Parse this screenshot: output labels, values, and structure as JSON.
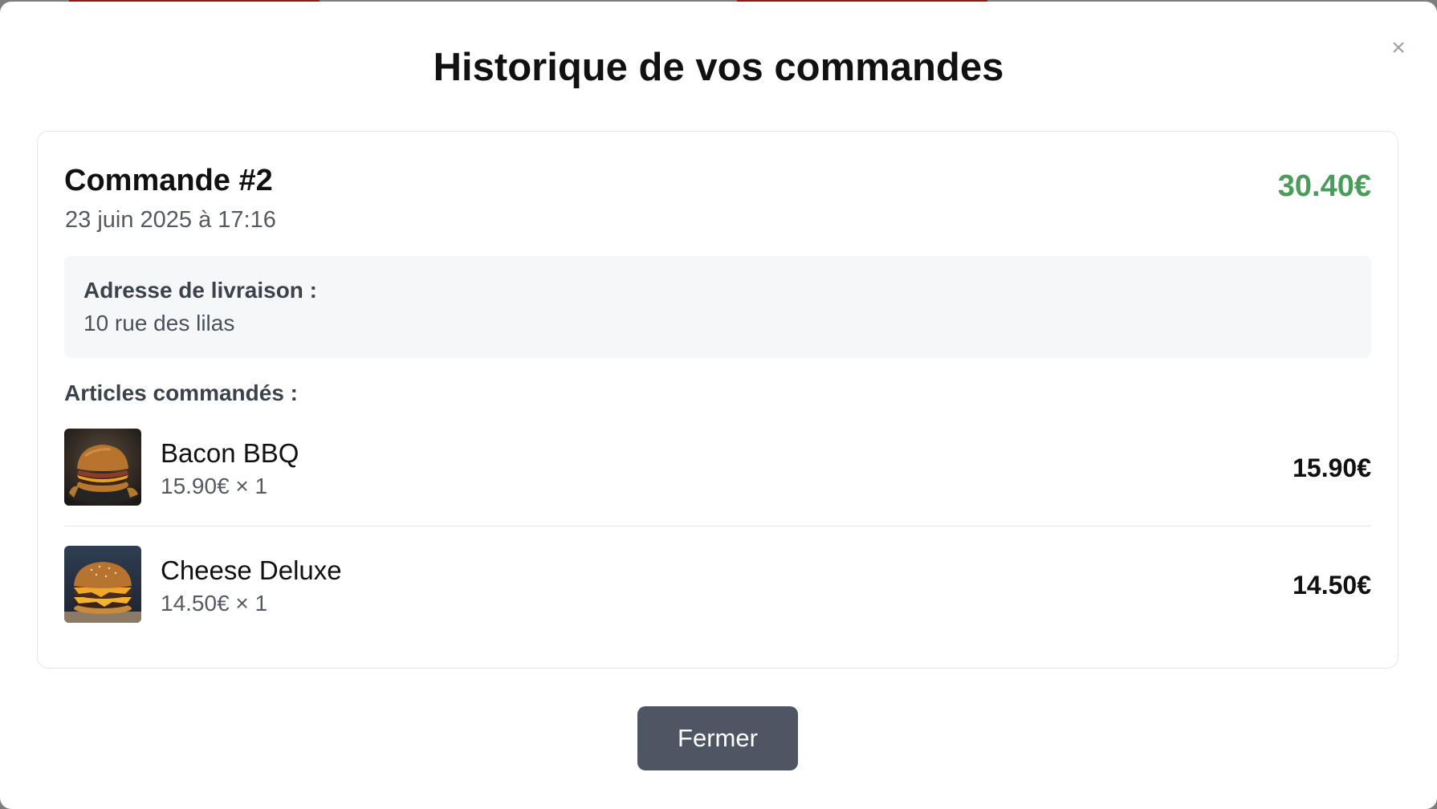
{
  "modal": {
    "title": "Historique de vos commandes",
    "close_symbol": "×",
    "close_icon": "close-icon"
  },
  "order": {
    "title": "Commande #2",
    "date": "23 juin 2025 à 17:16",
    "total": "30.40€",
    "total_color": "#4a9c5b",
    "address_label": "Adresse de livraison :",
    "address_value": "10 rue des lilas",
    "items_label": "Articles commandés :",
    "items": [
      {
        "name": "Bacon BBQ",
        "meta": "15.90€ × 1",
        "price": "15.90€",
        "image": "bacon-bbq-burger-image"
      },
      {
        "name": "Cheese Deluxe",
        "meta": "14.50€ × 1",
        "price": "14.50€",
        "image": "cheese-deluxe-burger-image"
      }
    ]
  },
  "footer": {
    "close_button_label": "Fermer",
    "button_color": "#4e5664"
  }
}
